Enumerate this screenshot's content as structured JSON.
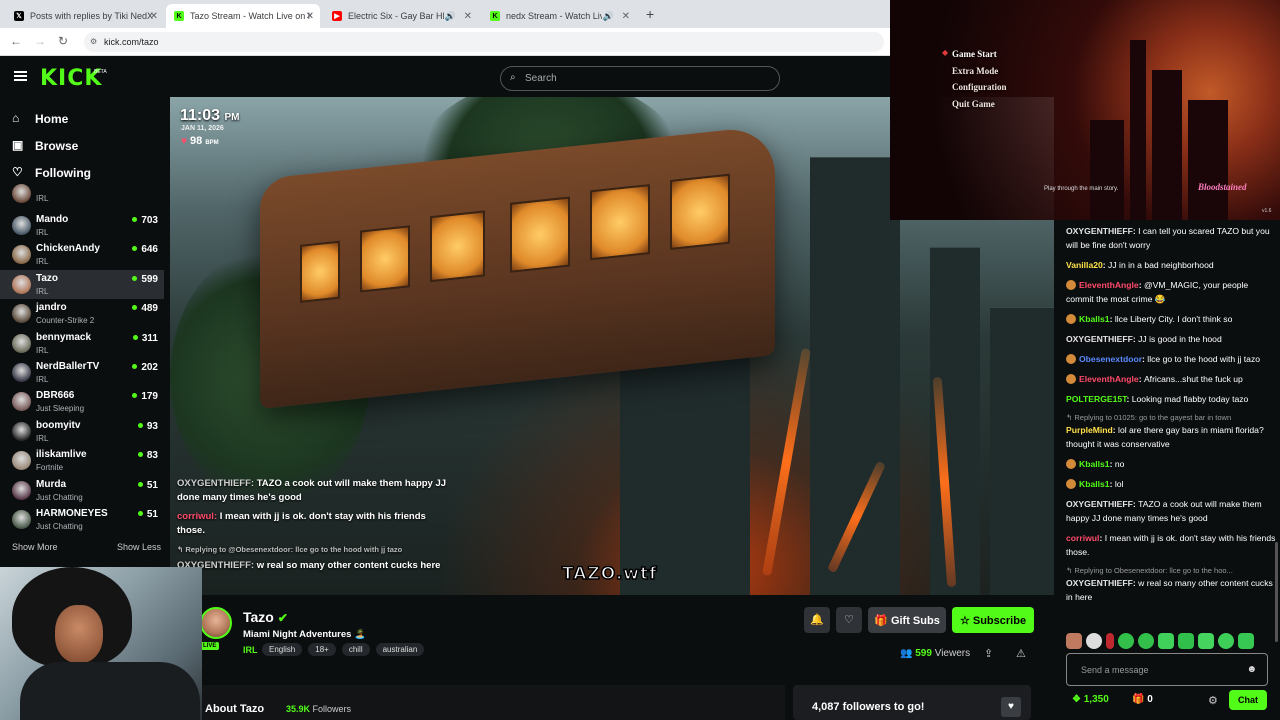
{
  "browser": {
    "tabs": [
      {
        "title": "Posts with replies by Tiki NedX",
        "icon": "x-logo-icon",
        "active": false
      },
      {
        "title": "Tazo Stream - Watch Live on Ki",
        "icon": "kick-logo-icon",
        "active": true
      },
      {
        "title": "Electric Six - Gay Bar HD -",
        "icon": "youtube-logo-icon",
        "active": false
      },
      {
        "title": "nedx Stream - Watch Live c",
        "icon": "kick-logo-icon",
        "active": false
      }
    ],
    "url": "kick.com/tazo"
  },
  "header": {
    "logo": "KICK",
    "logo_badge": "BETA",
    "search_placeholder": "Search"
  },
  "sidebar": {
    "nav": [
      {
        "label": "Home",
        "icon": "home-icon"
      },
      {
        "label": "Browse",
        "icon": "browse-icon"
      },
      {
        "label": "Following",
        "icon": "heart-icon"
      }
    ],
    "channels": [
      {
        "name": "",
        "category": "IRL",
        "viewers": "",
        "color": "#6b4a3a"
      },
      {
        "name": "Mando",
        "category": "IRL",
        "viewers": "703",
        "color": "#4a5a6a"
      },
      {
        "name": "ChickenAndy",
        "category": "IRL",
        "viewers": "646",
        "color": "#8a6a4a"
      },
      {
        "name": "Tazo",
        "category": "IRL",
        "viewers": "599",
        "color": "#b07658",
        "selected": true
      },
      {
        "name": "jandro",
        "category": "Counter-Strike 2",
        "viewers": "489",
        "color": "#5a4a3a"
      },
      {
        "name": "bennymack",
        "category": "IRL",
        "viewers": "311",
        "color": "#6a6a5a"
      },
      {
        "name": "NerdBallerTV",
        "category": "IRL",
        "viewers": "202",
        "color": "#3a3a4a"
      },
      {
        "name": "DBR666",
        "category": "Just Sleeping",
        "viewers": "179",
        "color": "#7a5a5a"
      },
      {
        "name": "boomyitv",
        "category": "IRL",
        "viewers": "93",
        "color": "#2a2a2a"
      },
      {
        "name": "iliskamlive",
        "category": "Fortnite",
        "viewers": "83",
        "color": "#9a8a7a"
      },
      {
        "name": "Murda",
        "category": "Just Chatting",
        "viewers": "51",
        "color": "#5a3a4a"
      },
      {
        "name": "HARMONEYES",
        "category": "Just Chatting",
        "viewers": "51",
        "color": "#4a5a4a"
      }
    ],
    "show_more": "Show More",
    "show_less": "Show Less"
  },
  "video": {
    "time": "11:03",
    "ampm": "PM",
    "date": "JAN 11, 2026",
    "bpm": "98",
    "bpm_unit": "BPM",
    "overlay_chat": [
      {
        "user": "OXYGENTHIEFF:",
        "text": "TAZO a cook out will make them happy JJ done many times he's good",
        "color": "#cfcfcf"
      },
      {
        "user": "corriwul:",
        "text": "I mean with jj is ok. don't stay with his friends those.",
        "color": "#ff4a6a"
      },
      {
        "reply": "↰ Replying to @Obesenextdoor: llce go to the hood with jj tazo"
      },
      {
        "user": "OXYGENTHIEFF:",
        "text": "w real so many other content cucks here",
        "color": "#cfcfcf"
      }
    ],
    "watermark": "TAZO.wtf"
  },
  "stream": {
    "name": "Tazo",
    "title": "Miami Night Adventures 🏝️",
    "live": "LIVE",
    "category": "IRL",
    "tags": [
      "English",
      "18+",
      "chill",
      "australian"
    ],
    "gift_label": "Gift Subs",
    "subscribe_label": "Subscribe",
    "viewers": "599",
    "viewers_label": "Viewers",
    "about_title": "About Tazo",
    "followers": "35.9K",
    "followers_label": "Followers",
    "goal": "4,087 followers to go!"
  },
  "game": {
    "menu": [
      "Game Start",
      "Extra Mode",
      "Configuration",
      "Quit Game"
    ],
    "hint": "Play through the main story.",
    "logo": "Bloodstained",
    "version": "v1.6"
  },
  "chat": {
    "messages": [
      {
        "user": "OXYGENTHIEFF",
        "color": "#e5e5e5",
        "text": "I can tell you scared TAZO but you will be fine don't worry"
      },
      {
        "user": "Vanilla20",
        "color": "#ffe14a",
        "text": "JJ in in a bad neighborhood"
      },
      {
        "user": "EleventhAngle",
        "color": "#ff4a6a",
        "text": "@VM_MAGIC, your people commit the most crime 😂",
        "badge": true
      },
      {
        "user": "Kballs1",
        "color": "#53fc18",
        "text": "llce Liberty City. I don't think so",
        "badge": true
      },
      {
        "user": "OXYGENTHIEFF",
        "color": "#e5e5e5",
        "text": "JJ is good in the hood"
      },
      {
        "user": "Obesenextdoor",
        "color": "#5a8aff",
        "text": "llce go to the hood with jj tazo",
        "badge": true
      },
      {
        "user": "EleventhAngle",
        "color": "#ff4a6a",
        "text": "Africans...shut the fuck up",
        "badge": true
      },
      {
        "user": "POLTERGE15T",
        "color": "#53fc18",
        "text": "Looking mad flabby today tazo"
      },
      {
        "reply": "↰ Replying to 01025: go to the gayest bar in town",
        "user": "PurpleMind",
        "color": "#ffe14a",
        "text": "lol are there gay bars in miami florida? thought it was conservative"
      },
      {
        "user": "Kballs1",
        "color": "#53fc18",
        "text": "no",
        "badge": true
      },
      {
        "user": "Kballs1",
        "color": "#53fc18",
        "text": "lol",
        "badge": true
      },
      {
        "user": "OXYGENTHIEFF",
        "color": "#e5e5e5",
        "text": "TAZO a cook out will make them happy JJ done many times he's good"
      },
      {
        "user": "corriwul",
        "color": "#ff4a6a",
        "text": "I mean with jj is ok. don't stay with his friends those."
      },
      {
        "reply": "↰ Replying to Obesenextdoor: llce go to the hoo...",
        "user": "OXYGENTHIEFF",
        "color": "#e5e5e5",
        "text": "w real so many other content cucks in here"
      }
    ],
    "input_placeholder": "Send a message",
    "points": "1,350",
    "kicks": "0",
    "send_label": "Chat"
  },
  "colors": {
    "accent": "#53fc18",
    "background": "#0b0e0f"
  }
}
